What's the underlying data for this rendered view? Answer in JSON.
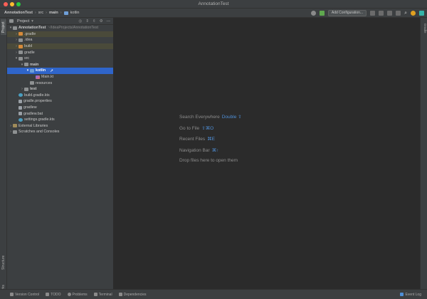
{
  "window": {
    "title": "AnnotationTest"
  },
  "navbar": {
    "crumbs": [
      "AnnotationTest",
      "src",
      "main",
      "kotlin"
    ],
    "add_config_label": "Add Configuration..."
  },
  "tool_tabs": {
    "project": "Project",
    "structure": "Structure",
    "bookmarks": "Bookmarks",
    "gradle": "Gradle"
  },
  "project_panel": {
    "header": "Project"
  },
  "tree": {
    "root": {
      "name": "AnnotationTest",
      "path": "~/IdeaProjects/AnnotationTest"
    },
    "items": [
      {
        "label": ".gradle"
      },
      {
        "label": ".idea"
      },
      {
        "label": "build"
      },
      {
        "label": "gradle"
      },
      {
        "label": "src"
      },
      {
        "label": "main"
      },
      {
        "label": "kotlin"
      },
      {
        "label": "Main.kt"
      },
      {
        "label": "resources"
      },
      {
        "label": "test"
      },
      {
        "label": "build.gradle.kts"
      },
      {
        "label": "gradle.properties"
      },
      {
        "label": "gradlew"
      },
      {
        "label": "gradlew.bat"
      },
      {
        "label": "settings.gradle.kts"
      },
      {
        "label": "External Libraries"
      },
      {
        "label": "Scratches and Consoles"
      }
    ]
  },
  "editor_hints": [
    {
      "text": "Search Everywhere",
      "key": "Double ⇧"
    },
    {
      "text": "Go to File",
      "key": "⇧⌘O"
    },
    {
      "text": "Recent Files",
      "key": "⌘E"
    },
    {
      "text": "Navigation Bar",
      "key": "⌘↑"
    },
    {
      "text": "Drop files here to open them",
      "key": ""
    }
  ],
  "statusbar": {
    "items": [
      "Version Control",
      "TODO",
      "Problems",
      "Terminal",
      "Dependencies"
    ],
    "event_log": "Event Log"
  }
}
